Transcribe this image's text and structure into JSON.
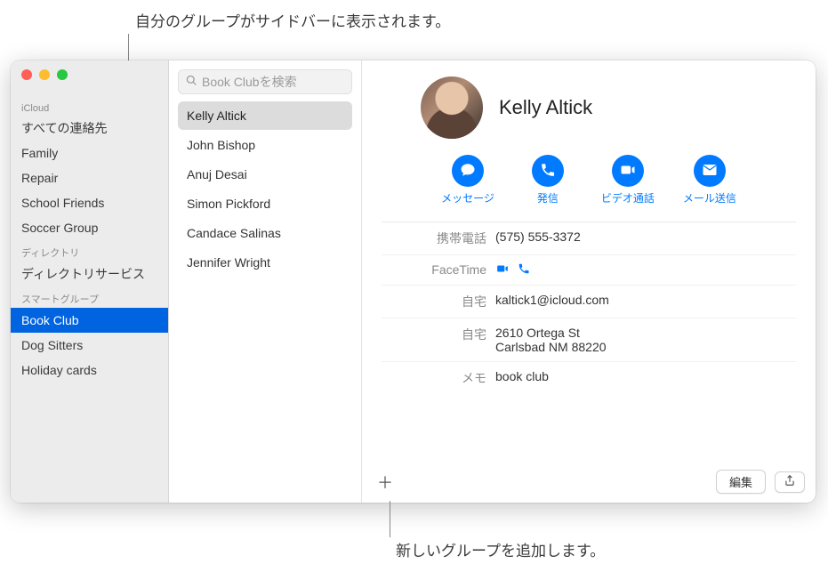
{
  "callouts": {
    "top": "自分のグループがサイドバーに表示されます。",
    "bottom": "新しいグループを追加します。"
  },
  "sidebar": {
    "sections": [
      {
        "label": "iCloud",
        "items": [
          {
            "name": "すべての連絡先",
            "selected": false
          },
          {
            "name": "Family",
            "selected": false
          },
          {
            "name": "Repair",
            "selected": false
          },
          {
            "name": "School Friends",
            "selected": false
          },
          {
            "name": "Soccer Group",
            "selected": false
          }
        ]
      },
      {
        "label": "ディレクトリ",
        "items": [
          {
            "name": "ディレクトリサービス",
            "selected": false
          }
        ]
      },
      {
        "label": "スマートグループ",
        "items": [
          {
            "name": "Book Club",
            "selected": true
          },
          {
            "name": "Dog Sitters",
            "selected": false
          },
          {
            "name": "Holiday cards",
            "selected": false
          }
        ]
      }
    ]
  },
  "search": {
    "placeholder": "Book Clubを検索"
  },
  "contacts": [
    {
      "name": "Kelly Altick",
      "selected": true
    },
    {
      "name": "John Bishop",
      "selected": false
    },
    {
      "name": "Anuj Desai",
      "selected": false
    },
    {
      "name": "Simon Pickford",
      "selected": false
    },
    {
      "name": "Candace Salinas",
      "selected": false
    },
    {
      "name": "Jennifer Wright",
      "selected": false
    }
  ],
  "card": {
    "name": "Kelly Altick",
    "actions": {
      "message": "メッセージ",
      "call": "発信",
      "video": "ビデオ通話",
      "mail": "メール送信"
    },
    "fields": {
      "mobile_label": "携帯電話",
      "mobile_value": "(575) 555-3372",
      "facetime_label": "FaceTime",
      "home_email_label": "自宅",
      "home_email_value": "kaltick1@icloud.com",
      "home_addr_label": "自宅",
      "home_addr_line1": "2610 Ortega St",
      "home_addr_line2": "Carlsbad NM 88220",
      "note_label": "メモ",
      "note_value": "book club"
    }
  },
  "buttons": {
    "edit": "編集"
  }
}
